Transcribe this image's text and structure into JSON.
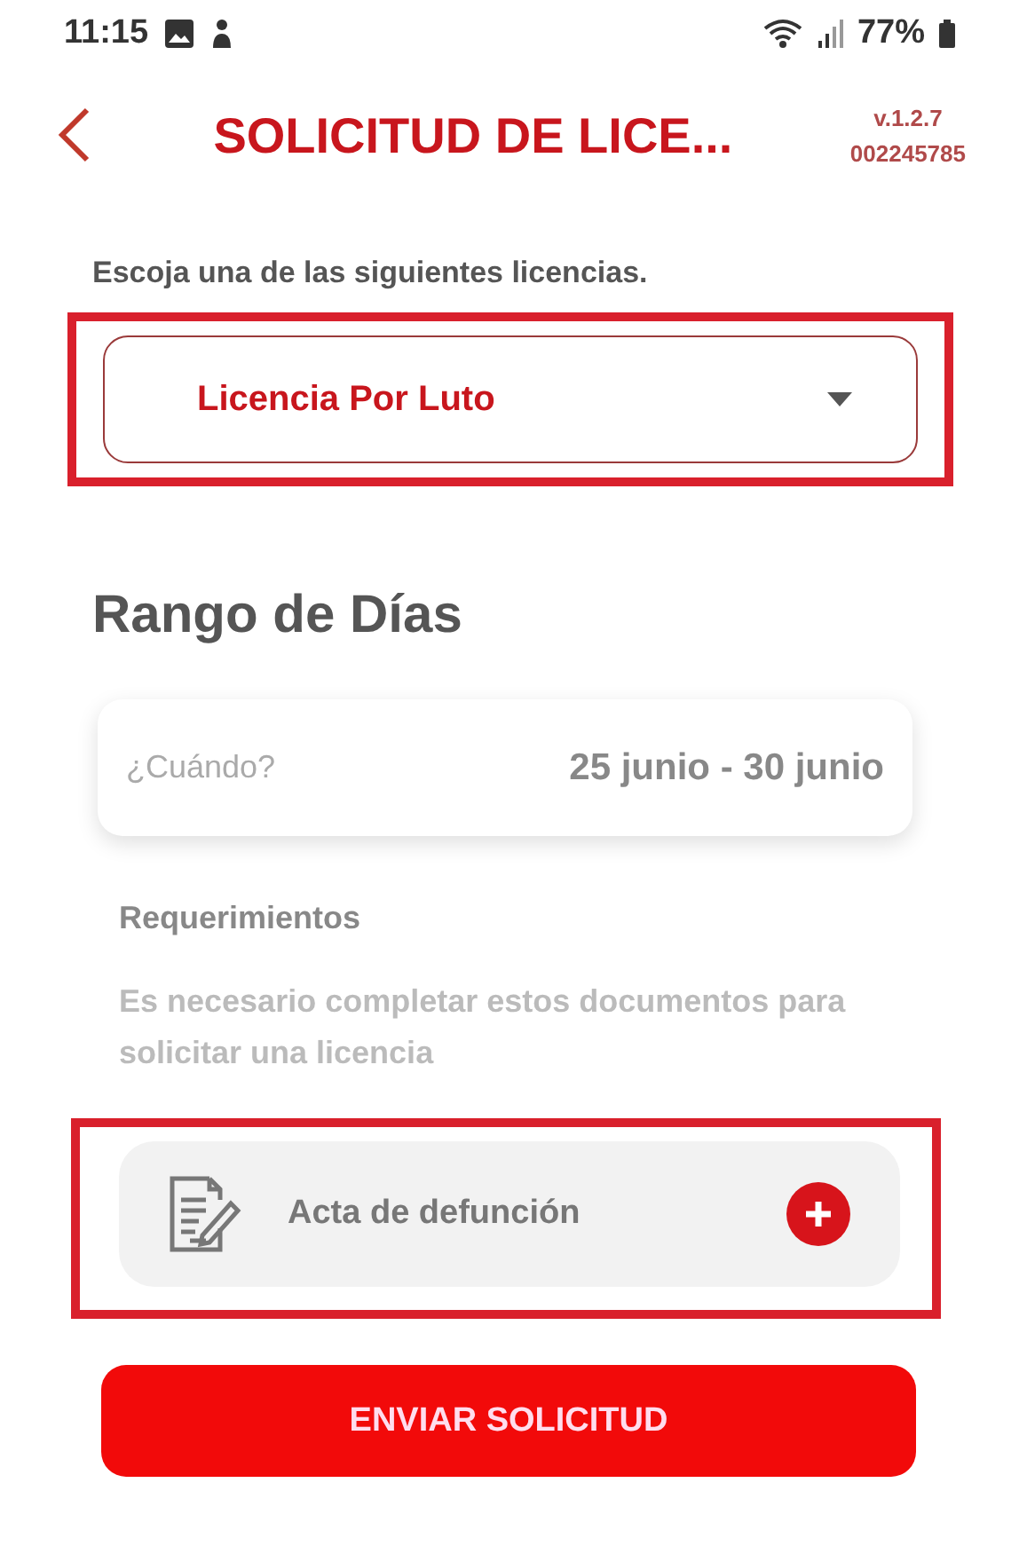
{
  "status_bar": {
    "time": "11:15",
    "battery": "77%"
  },
  "header": {
    "title": "SOLICITUD DE LICE...",
    "version": "v.1.2.7",
    "employee_id": "002245785"
  },
  "instruction": "Escoja una de las siguientes licencias.",
  "license_select": {
    "value": "Licencia Por Luto",
    "highlighted": true
  },
  "date_range": {
    "heading": "Rango de Días",
    "label": "¿Cuándo?",
    "value": "25 junio - 30 junio"
  },
  "requirements": {
    "heading": "Requerimientos",
    "description": "Es necesario completar estos documentos para solicitar una licencia",
    "documents": [
      {
        "name": "Acta de defunción",
        "highlighted": true
      }
    ]
  },
  "submit_button": "ENVIAR SOLICITUD"
}
